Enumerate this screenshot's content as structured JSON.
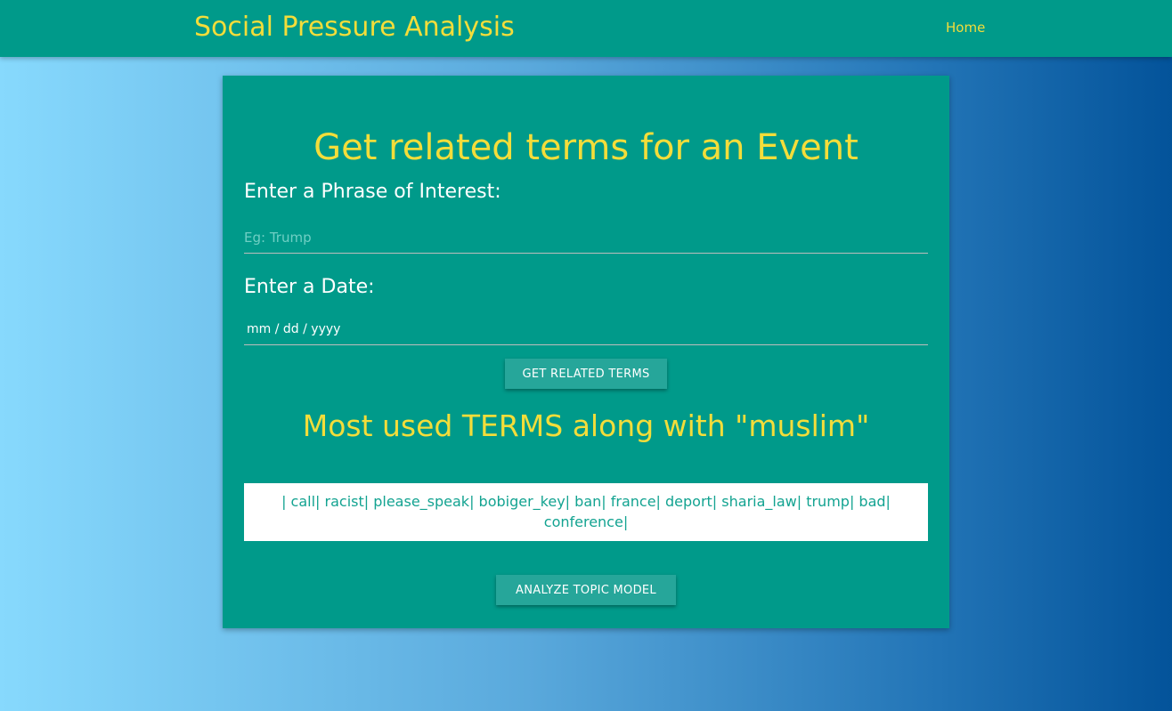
{
  "navbar": {
    "brand": "Social Pressure Analysis",
    "home_link": "Home"
  },
  "form": {
    "title": "Get related terms for an Event",
    "phrase_label": "Enter a Phrase of Interest:",
    "phrase_placeholder": "Eg: Trump",
    "phrase_value": "",
    "date_label": "Enter a Date:",
    "date_placeholder": "mm / dd / yyyy",
    "submit_label": "GET RELATED TERMS"
  },
  "results": {
    "title": "Most used TERMS along with \"muslim\"",
    "terms_text": "| call| racist| please_speak| bobiger_key| ban| france| deport| sharia_law| trump| bad| conference|",
    "analyze_label": "ANALYZE TOPIC MODEL"
  },
  "colors": {
    "navbar_bg": "#009a8a",
    "accent_yellow": "#f3dd3a",
    "button_bg": "#26a69a",
    "terms_text": "#13a391"
  }
}
